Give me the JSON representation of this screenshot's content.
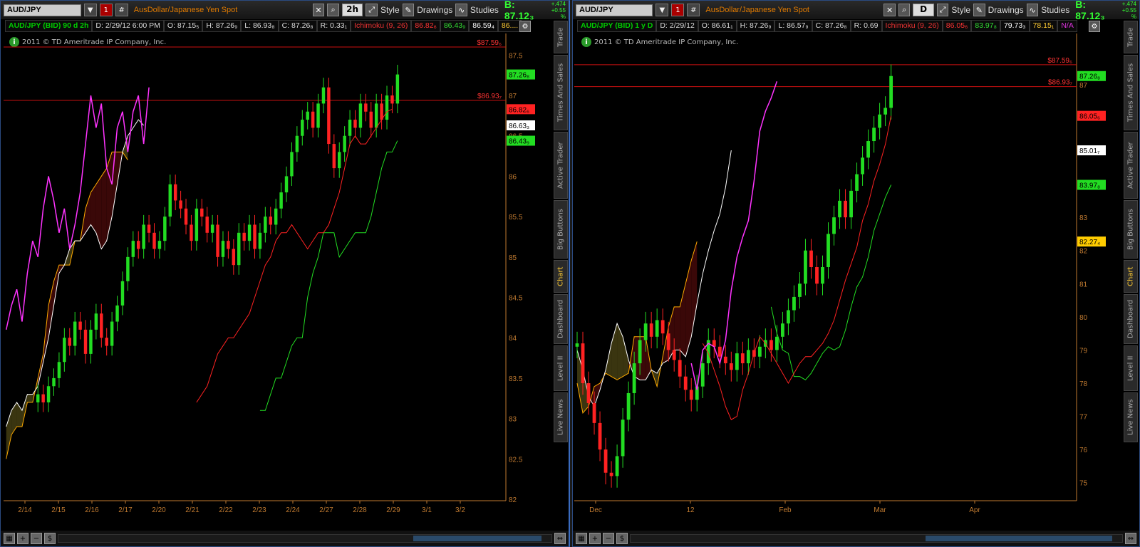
{
  "colors": {
    "price_line": "#ff2222",
    "tenkan": "#ff2222",
    "kijun": "#22dd22",
    "chikou": "#ff33ff",
    "span_a": "#ffffff",
    "span_b": "#ffaa00",
    "cloud": "#3a3510",
    "up": "#22dd22",
    "down": "#ff2222",
    "axis": "#c07a30"
  },
  "side_tabs": [
    "Trade",
    "Times And Sales",
    "Active Trader",
    "Big Buttons",
    "Chart",
    "Dashboard",
    "Level II",
    "Live News"
  ],
  "left": {
    "toolbar": {
      "symbol": "AUD/JPY",
      "desc": "AusDollar/Japanese Yen Spot",
      "agg": "2h",
      "style": "Style",
      "drawings": "Drawings",
      "studies": "Studies",
      "bid": "B: 87.12₃",
      "chg1": "+.474",
      "chg2": "+0.55 %"
    },
    "header": {
      "sym": "AUD/JPY (BID) 90 d 2h",
      "d": "D: 2/29/12 6:00 PM",
      "o": "O: 87.15₅",
      "h": "H: 87.26₉",
      "l": "L: 86.93₈",
      "c": "C: 87.26₈",
      "r": "R: 0.33₁",
      "ichi": "Ichimoku (9, 26)",
      "v1": "86.82₆",
      "v2": "86.43₉",
      "v3": "86.59₄",
      "v4": "86...."
    },
    "copyright": "2011 © TD Ameritrade IP Company, Inc.",
    "price_labels": [
      {
        "text": "87.26₈",
        "price": 87.26,
        "color": "#22dd22"
      },
      {
        "text": "86.82₆",
        "price": 86.83,
        "color": "#ff2222"
      },
      {
        "text": "86.63₃",
        "price": 86.63,
        "color": "#ffffff"
      },
      {
        "text": "86.43₉",
        "price": 86.44,
        "color": "#22dd22"
      }
    ],
    "hlines": [
      {
        "text": "$87.59₆",
        "price": 87.6
      },
      {
        "text": "$86.93₇",
        "price": 86.94
      }
    ]
  },
  "right": {
    "toolbar": {
      "symbol": "AUD/JPY",
      "desc": "AusDollar/Japanese Yen Spot",
      "agg": "D",
      "style": "Style",
      "drawings": "Drawings",
      "studies": "Studies",
      "bid": "B: 87.12₃",
      "chg1": "+.474",
      "chg2": "+0.55 %"
    },
    "header": {
      "sym": "AUD/JPY (BID) 1 y D",
      "d": "D: 2/29/12",
      "o": "O: 86.61₁",
      "h": "H: 87.26₉",
      "l": "L: 86.57₉",
      "c": "C: 87.26₈",
      "r": "R: 0.69",
      "ichi": "Ichimoku (9, 26)",
      "v1": "86.05₆",
      "v2": "83.97₈",
      "v3": "79.73₃",
      "v4": "78.15₁",
      "v5": "N/A"
    },
    "copyright": "2011 © TD Ameritrade IP Company, Inc.",
    "price_labels": [
      {
        "text": "87.26₈",
        "price": 87.26,
        "color": "#22dd22"
      },
      {
        "text": "86.05₆",
        "price": 86.06,
        "color": "#ff2222"
      },
      {
        "text": "85.01₇",
        "price": 85.02,
        "color": "#ffffff"
      },
      {
        "text": "83.97₈",
        "price": 83.98,
        "color": "#22dd22"
      },
      {
        "text": "82.27₄",
        "price": 82.27,
        "color": "#ffcc00"
      }
    ],
    "hlines": [
      {
        "text": "$87.59₆",
        "price": 87.6
      },
      {
        "text": "$86.93₇",
        "price": 86.94
      }
    ]
  },
  "chart_data": [
    {
      "type": "candlestick",
      "title": "AUD/JPY (BID) 90 d 2h",
      "ylim": [
        82,
        87.75
      ],
      "y_ticks": [
        82,
        82.5,
        83,
        83.5,
        84,
        84.5,
        85,
        85.5,
        86,
        86.5,
        87,
        87.5
      ],
      "x_ticks": [
        "2/14",
        "2/15",
        "2/16",
        "2/17",
        "2/20",
        "2/21",
        "2/22",
        "2/23",
        "2/24",
        "2/27",
        "2/28",
        "2/29",
        "3/1",
        "3/2"
      ],
      "series": {
        "close": [
          83.3,
          83.2,
          83.4,
          83.5,
          83.7,
          84.0,
          83.9,
          84.2,
          84.1,
          83.8,
          84.1,
          84.3,
          84.0,
          83.9,
          84.2,
          84.4,
          84.7,
          85.0,
          85.2,
          85.1,
          85.4,
          85.3,
          85.1,
          85.2,
          85.5,
          85.9,
          85.7,
          85.6,
          85.4,
          85.2,
          85.6,
          85.5,
          85.3,
          85.4,
          85.0,
          85.2,
          85.1,
          84.9,
          85.3,
          85.2,
          85.4,
          85.1,
          85.3,
          85.5,
          85.4,
          85.6,
          85.8,
          86.0,
          86.3,
          86.5,
          86.7,
          86.8,
          86.6,
          86.9,
          87.1,
          86.4,
          86.1,
          86.3,
          86.5,
          86.7,
          86.6,
          86.9,
          86.8,
          86.6,
          86.9,
          86.7,
          87.0,
          86.9,
          87.26
        ],
        "tenkan": [
          83.2,
          83.3,
          83.4,
          83.6,
          83.8,
          83.9,
          84.0,
          84.0,
          84.1,
          84.2,
          84.3,
          84.5,
          84.7,
          84.9,
          85.0,
          85.2,
          85.3,
          85.3,
          85.4,
          85.3,
          85.2,
          85.1,
          85.2,
          85.3,
          85.3,
          85.4,
          85.6,
          85.8,
          86.1,
          86.4,
          86.5,
          86.4,
          86.4,
          86.5,
          86.6,
          86.7,
          86.8,
          86.83
        ],
        "kijun": [
          83.1,
          83.1,
          83.3,
          83.5,
          83.5,
          83.7,
          83.9,
          84.0,
          84.0,
          84.5,
          84.8,
          85.0,
          85.3,
          85.3,
          85.3,
          85.0,
          85.1,
          85.2,
          85.3,
          85.3,
          85.3,
          85.5,
          85.8,
          86.1,
          86.3,
          86.3,
          86.44
        ],
        "span_a": [
          82.9,
          83.1,
          83.2,
          83.1,
          83.3,
          83.3,
          83.4,
          83.7,
          84.0,
          84.4,
          84.8,
          84.9,
          85.1,
          85.2,
          85.2,
          85.3,
          85.4,
          85.3,
          85.1,
          85.2,
          85.5,
          85.9,
          86.3,
          86.5,
          86.6,
          86.7,
          86.63
        ],
        "span_b": [
          82.5,
          82.8,
          82.9,
          82.9,
          83.2,
          83.2,
          83.5,
          83.8,
          84.4,
          84.7,
          84.9,
          84.9,
          84.9,
          85.2,
          85.2,
          85.6,
          85.8,
          85.9,
          86.0,
          86.1,
          86.3,
          86.3,
          86.3,
          86.2
        ],
        "chikou": [
          84.1,
          84.4,
          84.6,
          84.2,
          84.8,
          85.2,
          85.0,
          85.6,
          86.0,
          85.7,
          85.3,
          85.6,
          85.1,
          85.4,
          85.8,
          86.4,
          87.0,
          86.6,
          86.9,
          86.1,
          85.9,
          86.6,
          86.8,
          86.3,
          86.8,
          87.0,
          86.4,
          87.1
        ]
      }
    },
    {
      "type": "candlestick",
      "title": "AUD/JPY (BID) 1 y D",
      "ylim": [
        74.5,
        88.5
      ],
      "y_ticks": [
        75,
        76,
        77,
        78,
        79,
        80,
        81,
        82,
        83,
        84,
        85,
        86,
        87
      ],
      "x_ticks": [
        "Dec",
        "12",
        "Feb",
        "Mar",
        "Apr"
      ],
      "series": {
        "close": [
          79.2,
          78.0,
          77.4,
          76.8,
          76.0,
          75.3,
          75.2,
          75.8,
          76.9,
          77.7,
          78.6,
          79.3,
          79.8,
          79.4,
          79.9,
          79.5,
          79.0,
          78.7,
          78.2,
          77.8,
          77.5,
          77.9,
          78.6,
          79.3,
          79.1,
          78.8,
          78.6,
          78.4,
          78.9,
          78.6,
          79.0,
          78.8,
          79.1,
          79.3,
          79.0,
          79.4,
          79.8,
          80.2,
          80.6,
          81.0,
          82.0,
          81.5,
          81.0,
          81.5,
          82.5,
          83.0,
          83.5,
          83.0,
          83.8,
          84.3,
          84.8,
          85.3,
          85.7,
          86.1,
          86.3,
          87.26
        ],
        "tenkan": [
          79.2,
          78.9,
          78.4,
          77.9,
          77.3,
          76.9,
          77.0,
          77.8,
          78.3,
          78.9,
          79.4,
          79.2,
          78.9,
          78.6,
          78.3,
          78.0,
          78.3,
          78.6,
          78.8,
          78.8,
          79.0,
          79.2,
          79.5,
          79.9,
          80.5,
          81.1,
          81.6,
          82.1,
          82.9,
          83.4,
          84.1,
          84.6,
          85.2,
          86.06
        ],
        "kijun": [
          80.3,
          79.5,
          79.0,
          78.9,
          78.2,
          78.2,
          78.1,
          78.3,
          78.6,
          78.9,
          79.1,
          79.0,
          79.1,
          79.6,
          80.3,
          80.9,
          81.2,
          81.8,
          82.6,
          83.1,
          83.6,
          83.98
        ],
        "span_a": [
          79.0,
          78.4,
          77.6,
          77.3,
          77.8,
          78.4,
          79.2,
          79.8,
          79.4,
          78.7,
          78.2,
          78.1,
          78.1,
          78.4,
          78.3,
          78.6,
          78.7,
          79.0,
          79.0,
          78.8,
          79.4,
          80.4,
          81.3,
          82.0,
          82.6,
          83.1,
          83.9,
          85.02
        ],
        "span_b": [
          78.0,
          77.1,
          77.3,
          77.9,
          78.0,
          78.3,
          78.2,
          78.1,
          78.2,
          78.3,
          79.4,
          79.4,
          79.4,
          78.4,
          77.9,
          78.8,
          79.7,
          80.3,
          80.3,
          81.0,
          81.7,
          82.27
        ],
        "chikou": [
          78.6,
          77.8,
          79.0,
          79.2,
          79.1,
          78.6,
          79.3,
          80.8,
          81.8,
          82.4,
          82.9,
          84.1,
          85.6,
          86.2,
          86.6,
          87.1
        ]
      }
    }
  ]
}
